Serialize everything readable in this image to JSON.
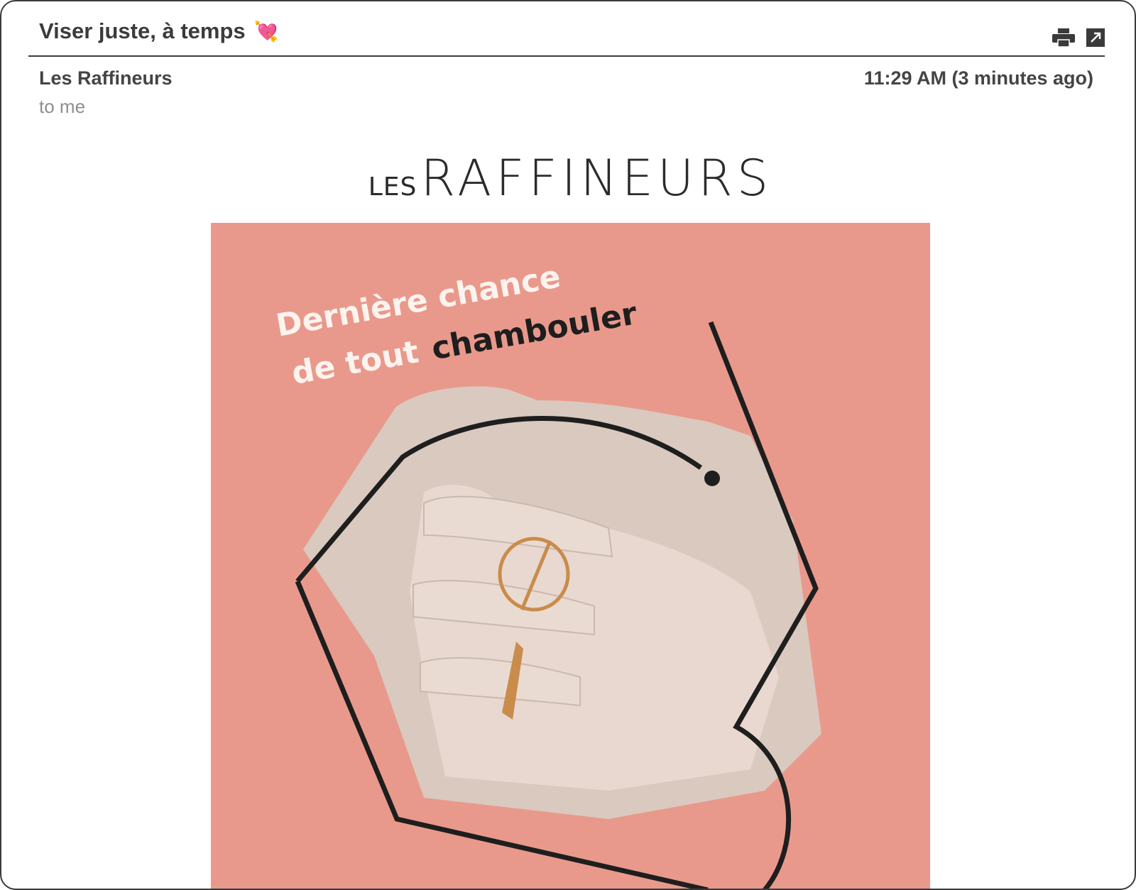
{
  "email": {
    "subject": "Viser juste, à temps",
    "subject_emoji": "💘",
    "sender": "Les Raffineurs",
    "recipient": "to me",
    "timestamp": "11:29 AM (3 minutes ago)"
  },
  "toolbar": {
    "print_icon": "printer-icon",
    "popout_icon": "open-in-new-window-icon"
  },
  "newsletter": {
    "logo_small": "LES",
    "logo_big": "RAFFINEURS",
    "headline_line1": "Dernière chance",
    "headline_line2a": "de tout",
    "headline_line2b": "chambouler",
    "colors": {
      "hero_background": "#e9998b",
      "headline_light": "#fdf3ef",
      "headline_dark": "#1e1e1e",
      "ring_gold": "#c98c4c"
    }
  }
}
